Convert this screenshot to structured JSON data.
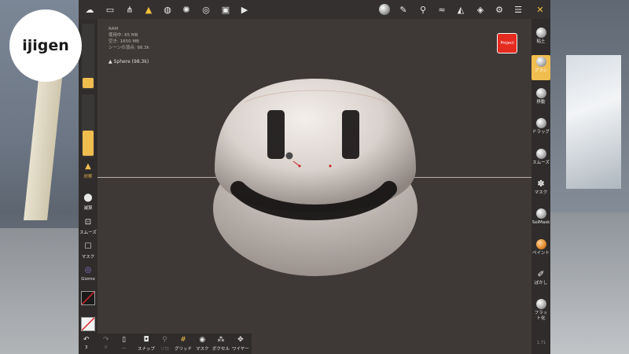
{
  "logo": {
    "text": "ijigen"
  },
  "top_toolbar": {
    "icons": [
      "cloud-icon",
      "folder-icon",
      "scene-graph-icon",
      "topology-icon",
      "globe-icon",
      "sun-icon",
      "material-icon",
      "image-icon",
      "video-icon",
      "matcap-icon",
      "pen-icon",
      "dropper-icon",
      "alpha-icon",
      "triangle-icon",
      "layers-icon",
      "settings-icon",
      "sliders-icon",
      "tools-icon"
    ],
    "active": "topology-icon"
  },
  "info_panel": {
    "line1": "RAM",
    "line2": "使用中: 65 MB",
    "line3": "空き: 1650 MB",
    "line4": "シーンの頂点: 98.3k",
    "object_label": "Sphere (98.3k)"
  },
  "project_button": {
    "label": "Project"
  },
  "left_panel": {
    "radius_fill": 0.2,
    "intensity_fill": 0.35,
    "items": [
      {
        "label": "対称",
        "icon": "warning-icon"
      },
      {
        "label": "減算",
        "icon": "drop-icon"
      },
      {
        "label": "スムーズ",
        "icon": "square-arrow-up-icon"
      },
      {
        "label": "マスク",
        "icon": "square-icon"
      },
      {
        "label": "Gizmo",
        "icon": "gizmo-icon"
      }
    ],
    "swatch1_color": "#1a1a1a",
    "swatch2_color": "#f3f3f3"
  },
  "right_panel": {
    "items": [
      {
        "label": "粘土",
        "icon": "clay-icon"
      },
      {
        "label": "ブラシ",
        "icon": "brush-icon",
        "active": true
      },
      {
        "label": "移動",
        "icon": "move-icon"
      },
      {
        "label": "ドラッグ",
        "icon": "drag-icon"
      },
      {
        "label": "スムーズ",
        "icon": "smooth-icon"
      },
      {
        "label": "マスク",
        "icon": "mask-icon"
      },
      {
        "label": "SelMask",
        "icon": "selmask-icon"
      },
      {
        "label": "ペイント",
        "icon": "paint-icon"
      },
      {
        "label": "ぼかし",
        "icon": "blur-icon"
      },
      {
        "label": "フラット化",
        "icon": "flatten-icon"
      }
    ]
  },
  "bottom_toolbar": {
    "items": [
      {
        "label": "3",
        "icon": "undo-icon"
      },
      {
        "label": "0",
        "icon": "redo-icon",
        "dim": true
      },
      {
        "label": "...",
        "icon": "phone-icon"
      },
      {
        "label": "スナップ",
        "icon": "snapshot-icon"
      },
      {
        "label": "ソロ",
        "icon": "solo-icon",
        "dim": true
      },
      {
        "label": "グリッド",
        "icon": "grid-icon"
      },
      {
        "label": "マスク",
        "icon": "eye-off-icon"
      },
      {
        "label": "ボクセル",
        "icon": "voxel-icon"
      },
      {
        "label": "ワイヤー",
        "icon": "wire-icon"
      }
    ]
  },
  "corner_text": "1.71",
  "colors": {
    "accent": "#f0bd4f",
    "project": "#e52b1f",
    "viewport": "#3e3936",
    "panel": "#2f2c2b"
  }
}
